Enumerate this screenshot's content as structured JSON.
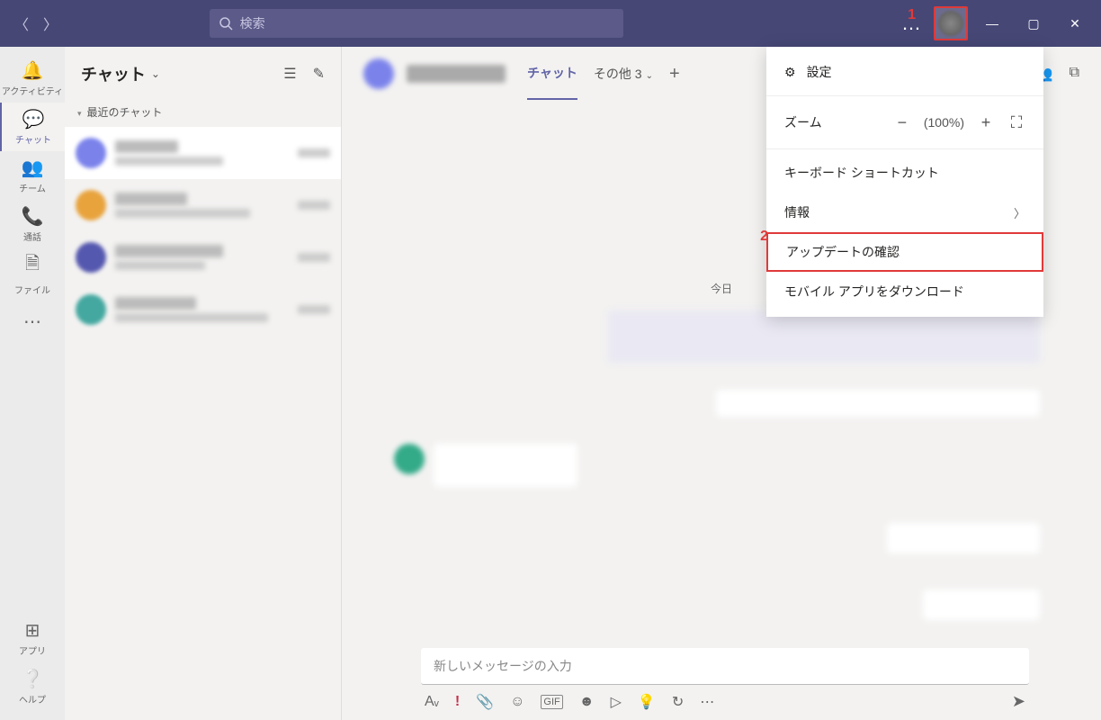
{
  "titlebar": {
    "search_placeholder": "検索"
  },
  "rail": {
    "activity": "アクティビティ",
    "chat": "チャット",
    "teams": "チーム",
    "calls": "通話",
    "files": "ファイル",
    "apps": "アプリ",
    "help": "ヘルプ"
  },
  "chatlist": {
    "title": "チャット",
    "section_recent": "最近のチャット"
  },
  "conv": {
    "tab_chat": "チャット",
    "tab_other": "その他 3",
    "date_today": "今日"
  },
  "composer": {
    "placeholder": "新しいメッセージの入力"
  },
  "dropdown": {
    "settings": "設定",
    "zoom_label": "ズーム",
    "zoom_value": "(100%)",
    "shortcuts": "キーボード ショートカット",
    "info": "情報",
    "check_update": "アップデートの確認",
    "mobile": "モバイル アプリをダウンロード"
  },
  "annotations": {
    "a1": "1",
    "a2": "2"
  }
}
